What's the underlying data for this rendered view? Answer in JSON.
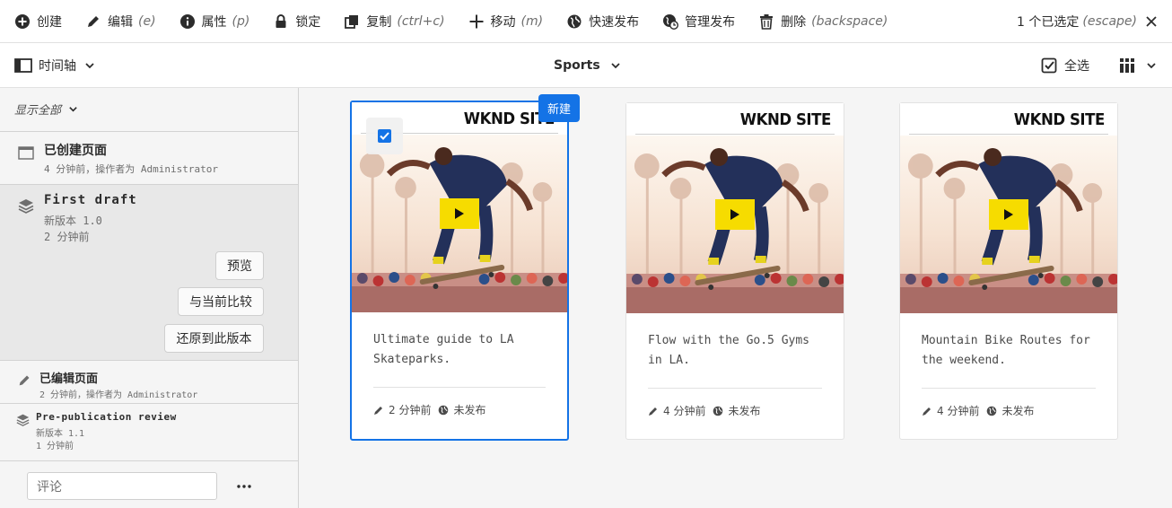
{
  "actionbar": {
    "create": "创建",
    "edit": "编辑",
    "edit_hint": "(e)",
    "properties": "属性",
    "properties_hint": "(p)",
    "lock": "锁定",
    "copy": "复制",
    "copy_hint": "(ctrl+c)",
    "move": "移动",
    "move_hint": "(m)",
    "quick_publish": "快速发布",
    "manage_publication": "管理发布",
    "delete": "删除",
    "delete_hint": "(backspace)",
    "selection_count": "1 个已选定",
    "selection_hint": "(escape)"
  },
  "subbar": {
    "rail_label": "时间轴",
    "breadcrumb": "Sports",
    "select_all": "全选"
  },
  "rail": {
    "filter": "显示全部",
    "items": [
      {
        "title": "已创建页面",
        "sub1": "4 分钟前，操作者为 Administrator",
        "icon": "page-icon"
      },
      {
        "title": "First draft",
        "sub1": "新版本 1.0",
        "sub2": "2 分钟前",
        "icon": "layers-icon"
      },
      {
        "title": "已编辑页面",
        "sub1": "2 分钟前，操作者为 Administrator",
        "icon": "pencil-icon"
      },
      {
        "title": "Pre-publication review",
        "sub1": "新版本 1.1",
        "sub2": "1 分钟前",
        "icon": "layers-icon"
      }
    ],
    "buttons": {
      "preview": "预览",
      "compare": "与当前比较",
      "revert": "还原到此版本"
    },
    "comment_placeholder": "评论"
  },
  "cards": [
    {
      "site": "WKND SITE",
      "title": "Ultimate guide to LA Skateparks.",
      "modified": "2 分钟前",
      "status": "未发布",
      "selected": true
    },
    {
      "site": "WKND SITE",
      "title": "Flow with the Go.5 Gyms in LA.",
      "modified": "4 分钟前",
      "status": "未发布",
      "selected": false
    },
    {
      "site": "WKND SITE",
      "title": "Mountain Bike Routes for the weekend.",
      "modified": "4 分钟前",
      "status": "未发布",
      "selected": false
    }
  ],
  "new_badge": "新建",
  "colors": {
    "accent": "#1473e6",
    "play": "#f6dc00"
  }
}
